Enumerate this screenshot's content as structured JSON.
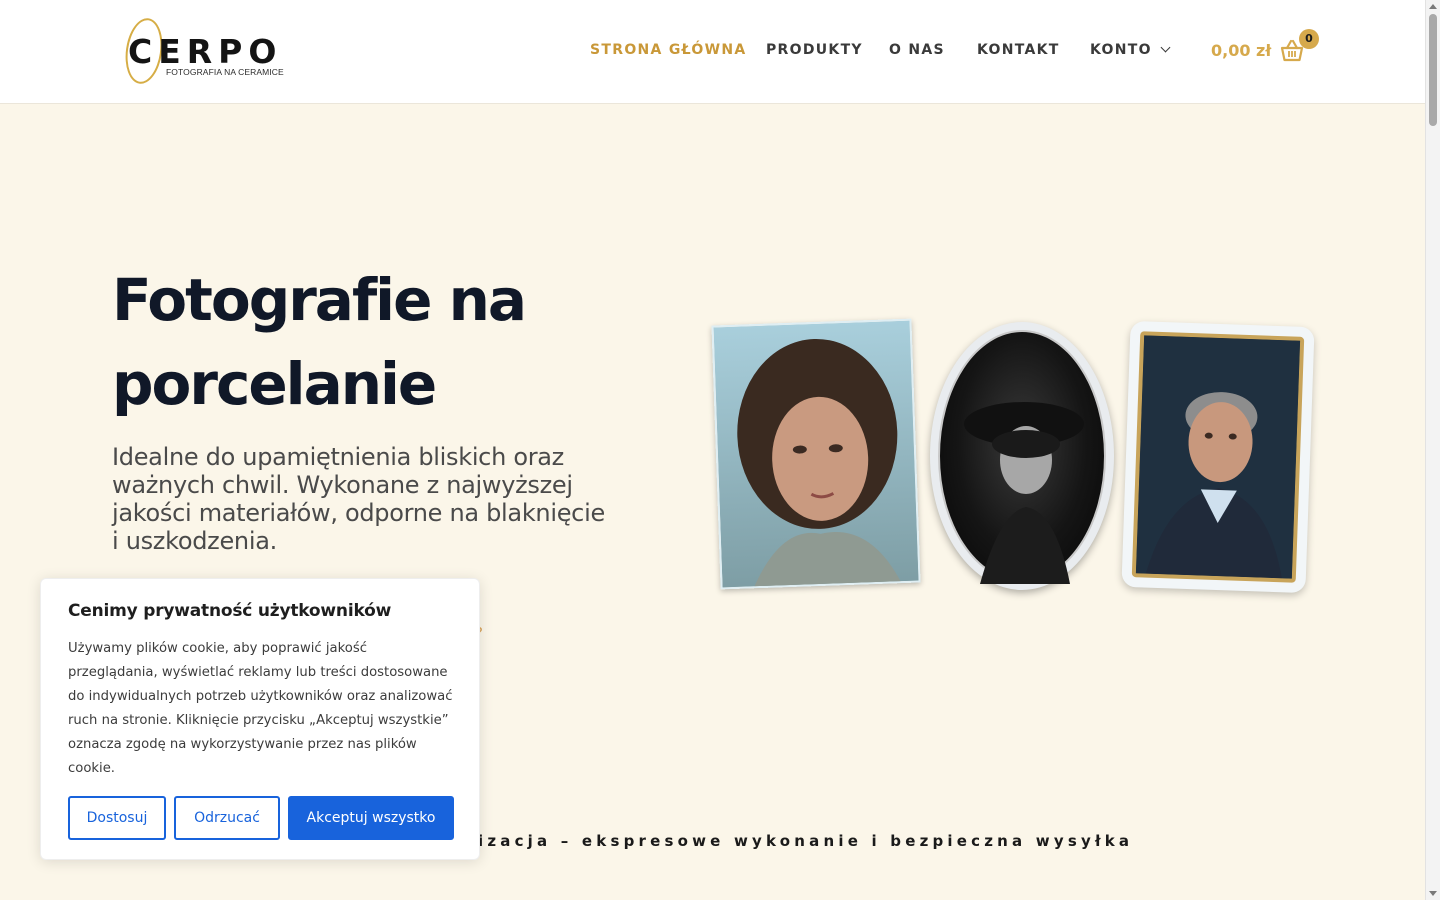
{
  "header": {
    "logo": {
      "word": "CERPO",
      "tagline": "FOTOGRAFIA NA CERAMICE"
    },
    "nav": [
      {
        "label": "STRONA GŁÓWNA",
        "active": true
      },
      {
        "label": "PRODUKTY",
        "active": false
      },
      {
        "label": "O NAS",
        "active": false
      },
      {
        "label": "KONTAKT",
        "active": false
      },
      {
        "label": "KONTO",
        "active": false,
        "has_dropdown": true
      }
    ],
    "cart": {
      "total": "0,00 zł",
      "count": "0",
      "icon": "basket-icon"
    }
  },
  "hero": {
    "title": "Fotografie na porcelanie",
    "subtitle": "Idealne do upamiętnienia bliskich oraz ważnych chwil. Wykonane z najwyższej jakości materiałów, odporne na blaknięcie i uszkodzenia.",
    "link_fragment": "?"
  },
  "ticker": {
    "text": "izacja – ekspresowe wykonanie i bezpieczna wysyłka"
  },
  "cookie_banner": {
    "title": "Cenimy prywatność użytkowników",
    "text": "Używamy plików cookie, aby poprawić jakość przeglądania, wyświetlać reklamy lub treści dostosowane do indywidualnych potrzeb użytkowników oraz analizować ruch na stronie. Kliknięcie przycisku „Akceptuj wszystkie” oznacza zgodę na wykorzystywanie przez nas plików cookie.",
    "buttons": {
      "customize": "Dostosuj",
      "reject": "Odrzucać",
      "accept": "Akceptuj wszystko"
    }
  },
  "colors": {
    "accent_gold": "#c99838",
    "hero_bg": "#fbf6e9",
    "cookie_blue": "#1863dc",
    "heading_dark": "#101828"
  }
}
